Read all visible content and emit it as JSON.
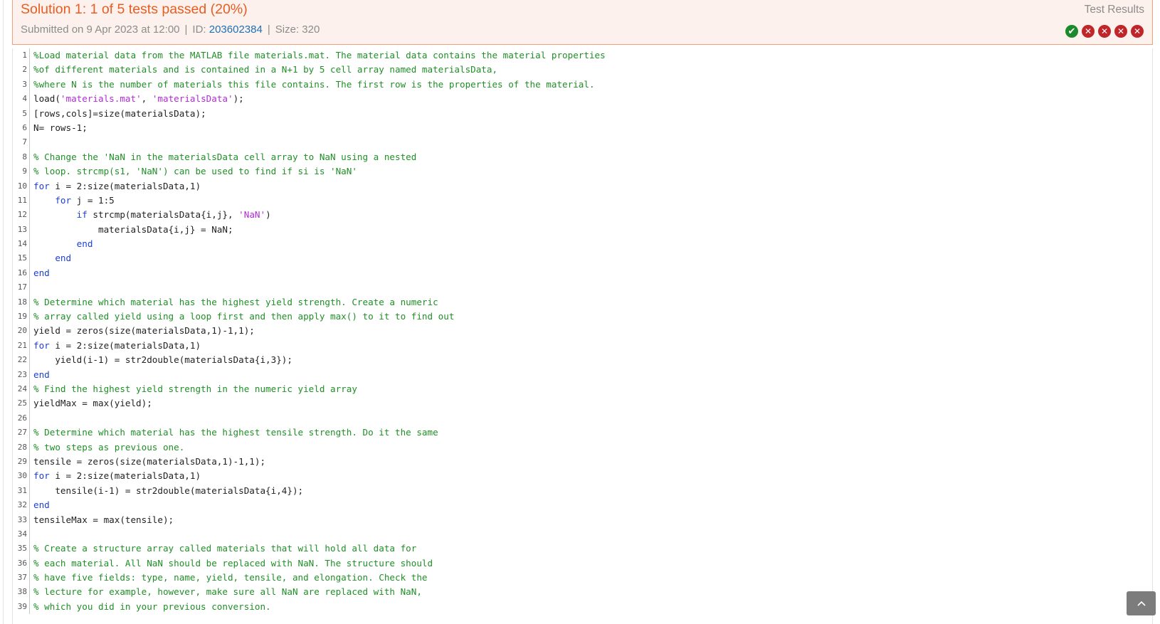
{
  "header": {
    "title": "Solution 1: 1 of 5 tests passed (20%)",
    "submitted": "Submitted on 9 Apr 2023 at 12:00",
    "id_label": "ID:",
    "id_value": "203602384",
    "size_label": "Size: 320",
    "results_label": "Test Results",
    "results": [
      "pass",
      "fail",
      "fail",
      "fail",
      "fail"
    ]
  },
  "colors": {
    "accent": "#e85d21",
    "pass": "#1c8a2c",
    "fail": "#c0252a",
    "link": "#1e71b4",
    "comment": "#1f8f26",
    "keyword": "#1e40d2",
    "string": "#b22bd6"
  },
  "code": {
    "lines": [
      {
        "n": "1",
        "t": "%Load material data from the MATLAB file materials.mat. The material data contains the material properties",
        "c": true
      },
      {
        "n": "2",
        "t": "%of different materials and is contained in a N+1 by 5 cell array named materialsData,",
        "c": true
      },
      {
        "n": "3",
        "t": "%where N is the number of materials this file contains. The first row is the properties of the material.",
        "c": true
      },
      {
        "n": "4",
        "t": "load('materials.mat', 'materialsData');"
      },
      {
        "n": "5",
        "t": "[rows,cols]=size(materialsData);"
      },
      {
        "n": "6",
        "t": "N= rows-1;"
      },
      {
        "n": "7",
        "t": ""
      },
      {
        "n": "8",
        "t": "% Change the 'NaN in the materialsData cell array to NaN using a nested",
        "c": true
      },
      {
        "n": "9",
        "t": "% loop. strcmp(s1, 'NaN') can be used to find if si is 'NaN'",
        "c": true
      },
      {
        "n": "10",
        "t": "for i = 2:size(materialsData,1)"
      },
      {
        "n": "11",
        "t": "    for j = 1:5"
      },
      {
        "n": "12",
        "t": "        if strcmp(materialsData{i,j}, 'NaN')"
      },
      {
        "n": "13",
        "t": "            materialsData{i,j} = NaN;"
      },
      {
        "n": "14",
        "t": "        end"
      },
      {
        "n": "15",
        "t": "    end"
      },
      {
        "n": "16",
        "t": "end"
      },
      {
        "n": "17",
        "t": ""
      },
      {
        "n": "18",
        "t": "% Determine which material has the highest yield strength. Create a numeric",
        "c": true
      },
      {
        "n": "19",
        "t": "% array called yield using a loop first and then apply max() to it to find out",
        "c": true
      },
      {
        "n": "20",
        "t": "yield = zeros(size(materialsData,1)-1,1);"
      },
      {
        "n": "21",
        "t": "for i = 2:size(materialsData,1)"
      },
      {
        "n": "22",
        "t": "    yield(i-1) = str2double(materialsData{i,3});"
      },
      {
        "n": "23",
        "t": "end"
      },
      {
        "n": "24",
        "t": "% Find the highest yield strength in the numeric yield array",
        "c": true
      },
      {
        "n": "25",
        "t": "yieldMax = max(yield);"
      },
      {
        "n": "26",
        "t": ""
      },
      {
        "n": "27",
        "t": "% Determine which material has the highest tensile strength. Do it the same",
        "c": true
      },
      {
        "n": "28",
        "t": "% two steps as previous one.",
        "c": true
      },
      {
        "n": "29",
        "t": "tensile = zeros(size(materialsData,1)-1,1);"
      },
      {
        "n": "30",
        "t": "for i = 2:size(materialsData,1)"
      },
      {
        "n": "31",
        "t": "    tensile(i-1) = str2double(materialsData{i,4});"
      },
      {
        "n": "32",
        "t": "end"
      },
      {
        "n": "33",
        "t": "tensileMax = max(tensile);"
      },
      {
        "n": "34",
        "t": ""
      },
      {
        "n": "35",
        "t": "% Create a structure array called materials that will hold all data for",
        "c": true
      },
      {
        "n": "36",
        "t": "% each material. All NaN should be replaced with NaN. The structure should",
        "c": true
      },
      {
        "n": "37",
        "t": "% have five fields: type, name, yield, tensile, and elongation. Check the",
        "c": true
      },
      {
        "n": "38",
        "t": "% lecture for example, however, make sure all NaN are replaced with NaN,",
        "c": true
      },
      {
        "n": "39",
        "t": "% which you did in your previous conversion.",
        "c": true
      }
    ]
  },
  "icons": {
    "pass": "check-circle-icon",
    "fail": "x-circle-icon",
    "scroll_top": "chevron-up-icon"
  }
}
